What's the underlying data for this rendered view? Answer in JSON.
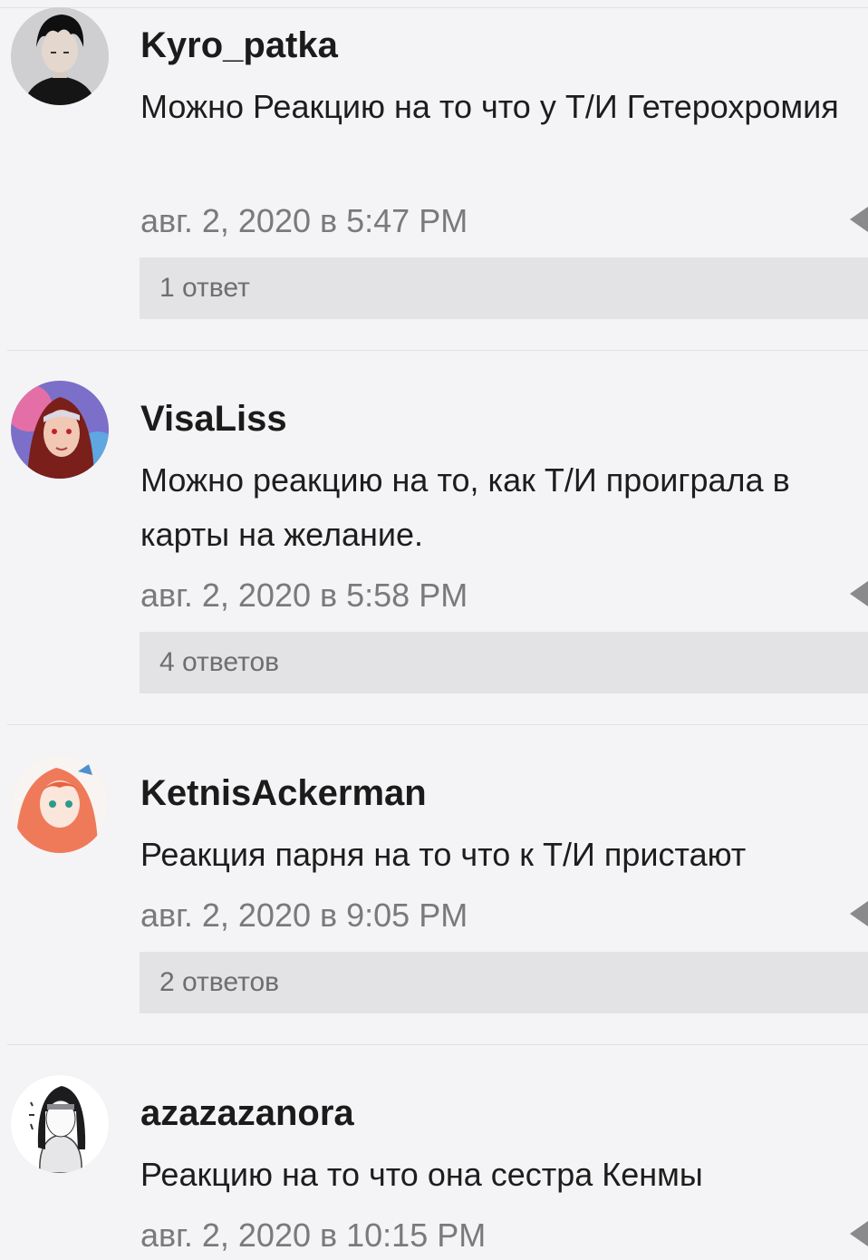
{
  "comments": [
    {
      "author": "Kyro_patka",
      "text": "Можно Реакцию на то что у Т/И Гетерохромия",
      "date": "авг. 2, 2020 в 5:47 PM",
      "replies": "1 ответ",
      "avatar_icon": "avatar-dark-hair-man"
    },
    {
      "author": "VisaLiss",
      "text": "Можно реакцию на то, как Т/И проиграла в карты на желание.",
      "date": "авг. 2, 2020 в 5:58 PM",
      "replies": "4 ответов",
      "avatar_icon": "avatar-red-hair-girl"
    },
    {
      "author": "KetnisAckerman",
      "text": "Реакция парня на то что к Т/И пристают",
      "date": "авг. 2, 2020 в 9:05 PM",
      "replies": "2 ответов",
      "avatar_icon": "avatar-orange-hair-anime-girl"
    },
    {
      "author": "azazazanora",
      "text": "Реакцию на то что она сестра Кенмы",
      "date": "авг. 2, 2020 в 10:15 PM",
      "avatar_icon": "avatar-sketch-anime-character"
    }
  ],
  "colors": {
    "background": "#f4f4f6",
    "replies_bg": "#e3e3e5",
    "date_text": "#7a7a7c",
    "author_text": "#1b1b1b"
  }
}
